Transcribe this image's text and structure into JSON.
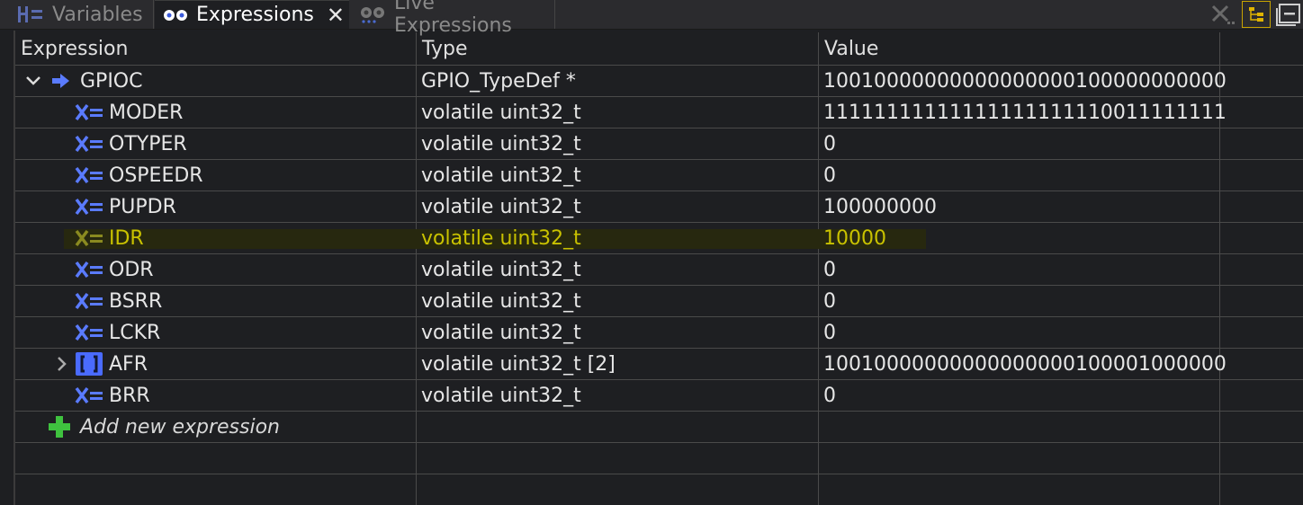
{
  "tabs": [
    {
      "label": "Variables",
      "icon": "variables-icon"
    },
    {
      "label": "Expressions",
      "icon": "expressions-icon",
      "active": true
    },
    {
      "label": "Live Expressions",
      "icon": "live-expressions-icon"
    }
  ],
  "columns": {
    "expression": "Expression",
    "type": "Type",
    "value": "Value"
  },
  "root": {
    "name": "GPIOC",
    "type": "GPIO_TypeDef *",
    "value": "10010000000000000000100000000000"
  },
  "children": [
    {
      "name": "MODER",
      "type": "volatile uint32_t",
      "value": "11111111111111111111110011111111"
    },
    {
      "name": "OTYPER",
      "type": "volatile uint32_t",
      "value": "0"
    },
    {
      "name": "OSPEEDR",
      "type": "volatile uint32_t",
      "value": "0"
    },
    {
      "name": "PUPDR",
      "type": "volatile uint32_t",
      "value": "100000000"
    },
    {
      "name": "IDR",
      "type": "volatile uint32_t",
      "value": "10000",
      "changed": true
    },
    {
      "name": "ODR",
      "type": "volatile uint32_t",
      "value": "0"
    },
    {
      "name": "BSRR",
      "type": "volatile uint32_t",
      "value": "0"
    },
    {
      "name": "LCKR",
      "type": "volatile uint32_t",
      "value": "0"
    },
    {
      "name": "AFR",
      "type": "volatile uint32_t [2]",
      "value": "10010000000000000000100001000000",
      "array": true
    },
    {
      "name": "BRR",
      "type": "volatile uint32_t",
      "value": "0"
    }
  ],
  "add_expression": "Add new expression",
  "colors": {
    "accent": "#5a7bff",
    "changed": "#c9c200",
    "add": "#3fc23f"
  }
}
